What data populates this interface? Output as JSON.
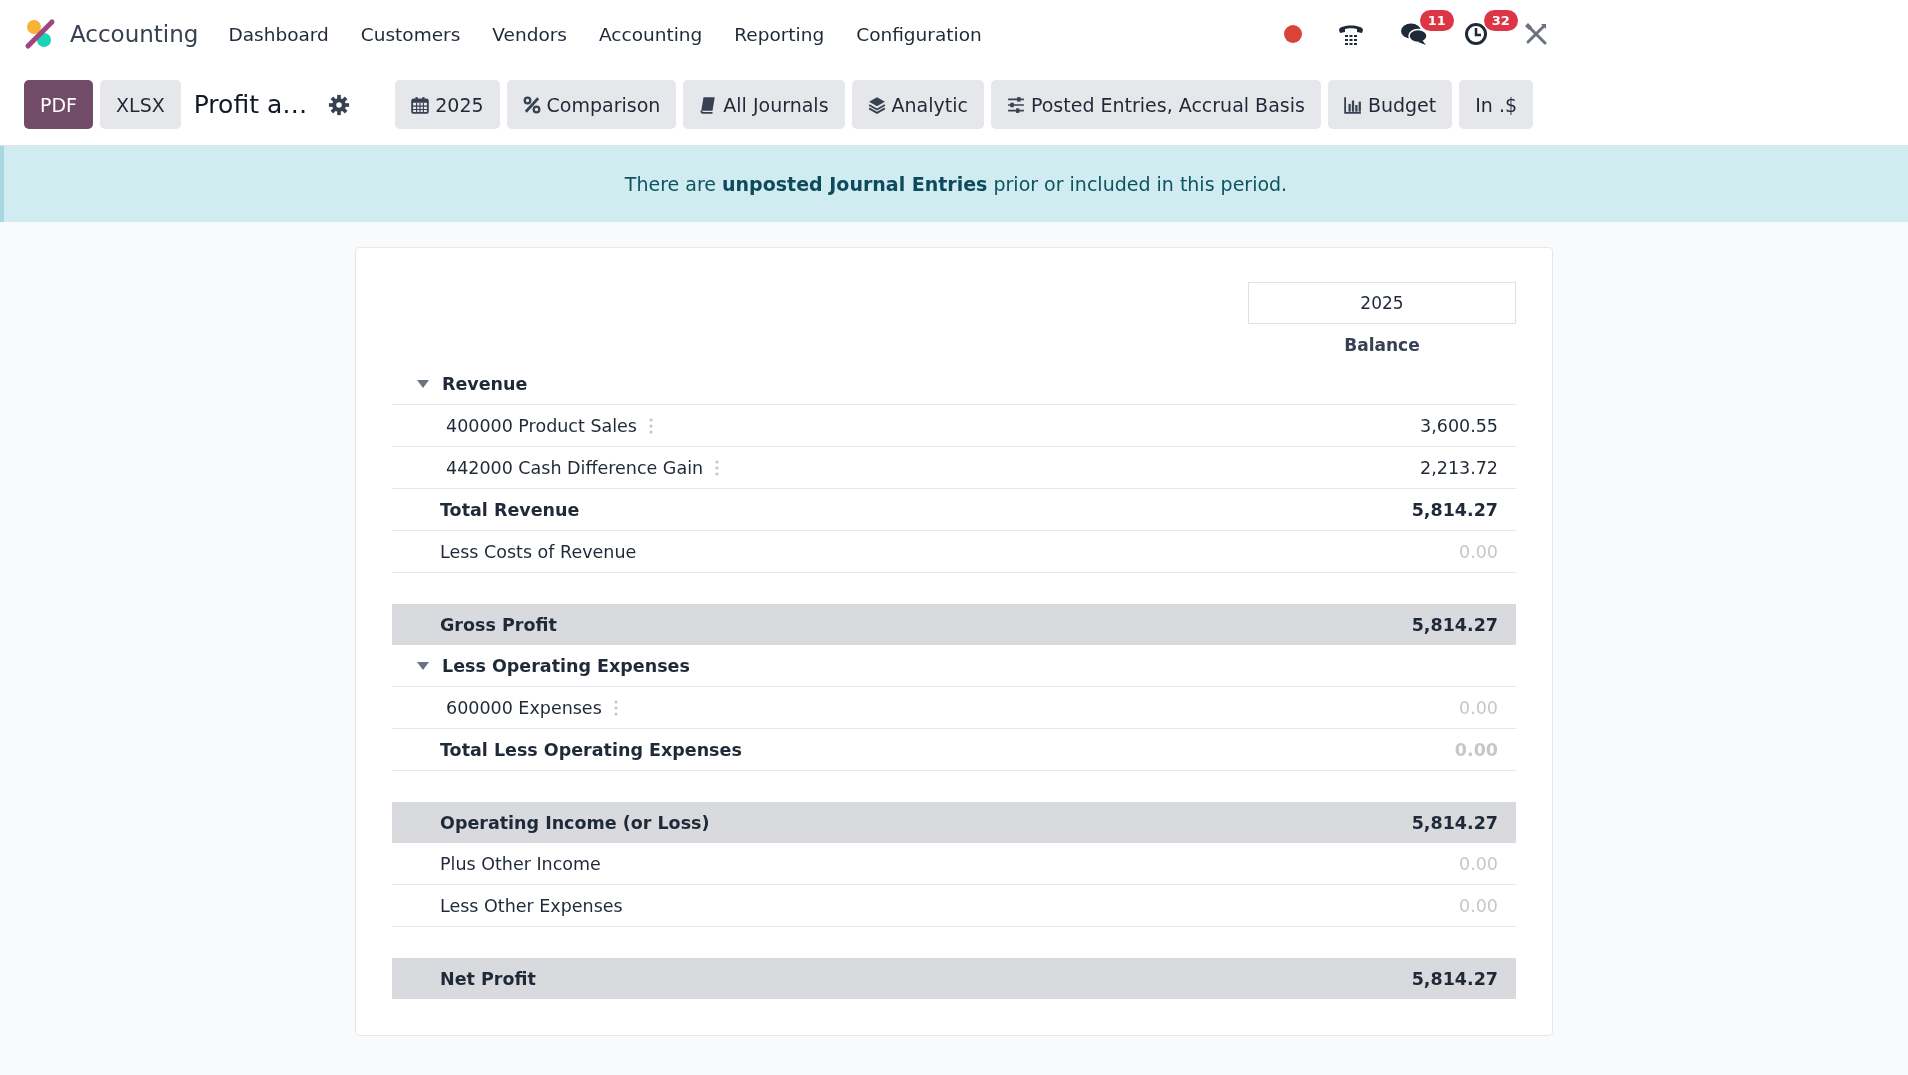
{
  "navbar": {
    "app_name": "Accounting",
    "menu": [
      "Dashboard",
      "Customers",
      "Vendors",
      "Accounting",
      "Reporting",
      "Configuration"
    ],
    "systray": [
      {
        "kind": "status-dot",
        "color": "#d9443a"
      },
      {
        "kind": "phone"
      },
      {
        "kind": "chat",
        "badge": "11"
      },
      {
        "kind": "activity",
        "badge": "32"
      },
      {
        "kind": "tools"
      }
    ]
  },
  "toolbar": {
    "export_buttons": [
      {
        "label": "PDF",
        "primary": true
      },
      {
        "label": "XLSX",
        "primary": false
      }
    ],
    "report_title": "Profit a…",
    "filters": [
      {
        "kind": "date",
        "label": "2025"
      },
      {
        "kind": "comparison",
        "label": "Comparison"
      },
      {
        "kind": "journals",
        "label": "All Journals"
      },
      {
        "kind": "analytic",
        "label": "Analytic"
      },
      {
        "kind": "options",
        "label": "Posted Entries, Accrual Basis"
      },
      {
        "kind": "budget",
        "label": "Budget"
      },
      {
        "kind": "currency",
        "label": "In .$"
      }
    ]
  },
  "alert": {
    "text": "There are **unposted Journal Entries** prior or included in this period."
  },
  "report": {
    "period": "2025",
    "column": "Balance",
    "rows": [
      {
        "kind": "section",
        "label": "Revenue",
        "expanded": true
      },
      {
        "kind": "account",
        "label": "400000 Product Sales",
        "value": "3,600.55",
        "muted": false
      },
      {
        "kind": "account",
        "label": "442000 Cash Difference Gain",
        "value": "2,213.72",
        "muted": false
      },
      {
        "kind": "total",
        "label": "Total Revenue",
        "value": "5,814.27",
        "muted": false
      },
      {
        "kind": "line",
        "label": "Less Costs of Revenue",
        "value": "0.00",
        "muted": true
      },
      {
        "kind": "spacer"
      },
      {
        "kind": "band",
        "label": "Gross Profit",
        "value": "5,814.27",
        "muted": false
      },
      {
        "kind": "section",
        "label": "Less Operating Expenses",
        "expanded": true
      },
      {
        "kind": "account",
        "label": "600000 Expenses",
        "value": "0.00",
        "muted": true
      },
      {
        "kind": "total",
        "label": "Total Less Operating Expenses",
        "value": "0.00",
        "muted": true
      },
      {
        "kind": "spacer"
      },
      {
        "kind": "band",
        "label": "Operating Income (or Loss)",
        "value": "5,814.27",
        "muted": false
      },
      {
        "kind": "line",
        "label": "Plus Other Income",
        "value": "0.00",
        "muted": true
      },
      {
        "kind": "line",
        "label": "Less Other Expenses",
        "value": "0.00",
        "muted": true
      },
      {
        "kind": "spacer"
      },
      {
        "kind": "band",
        "label": "Net Profit",
        "value": "5,814.27",
        "muted": false
      }
    ]
  }
}
